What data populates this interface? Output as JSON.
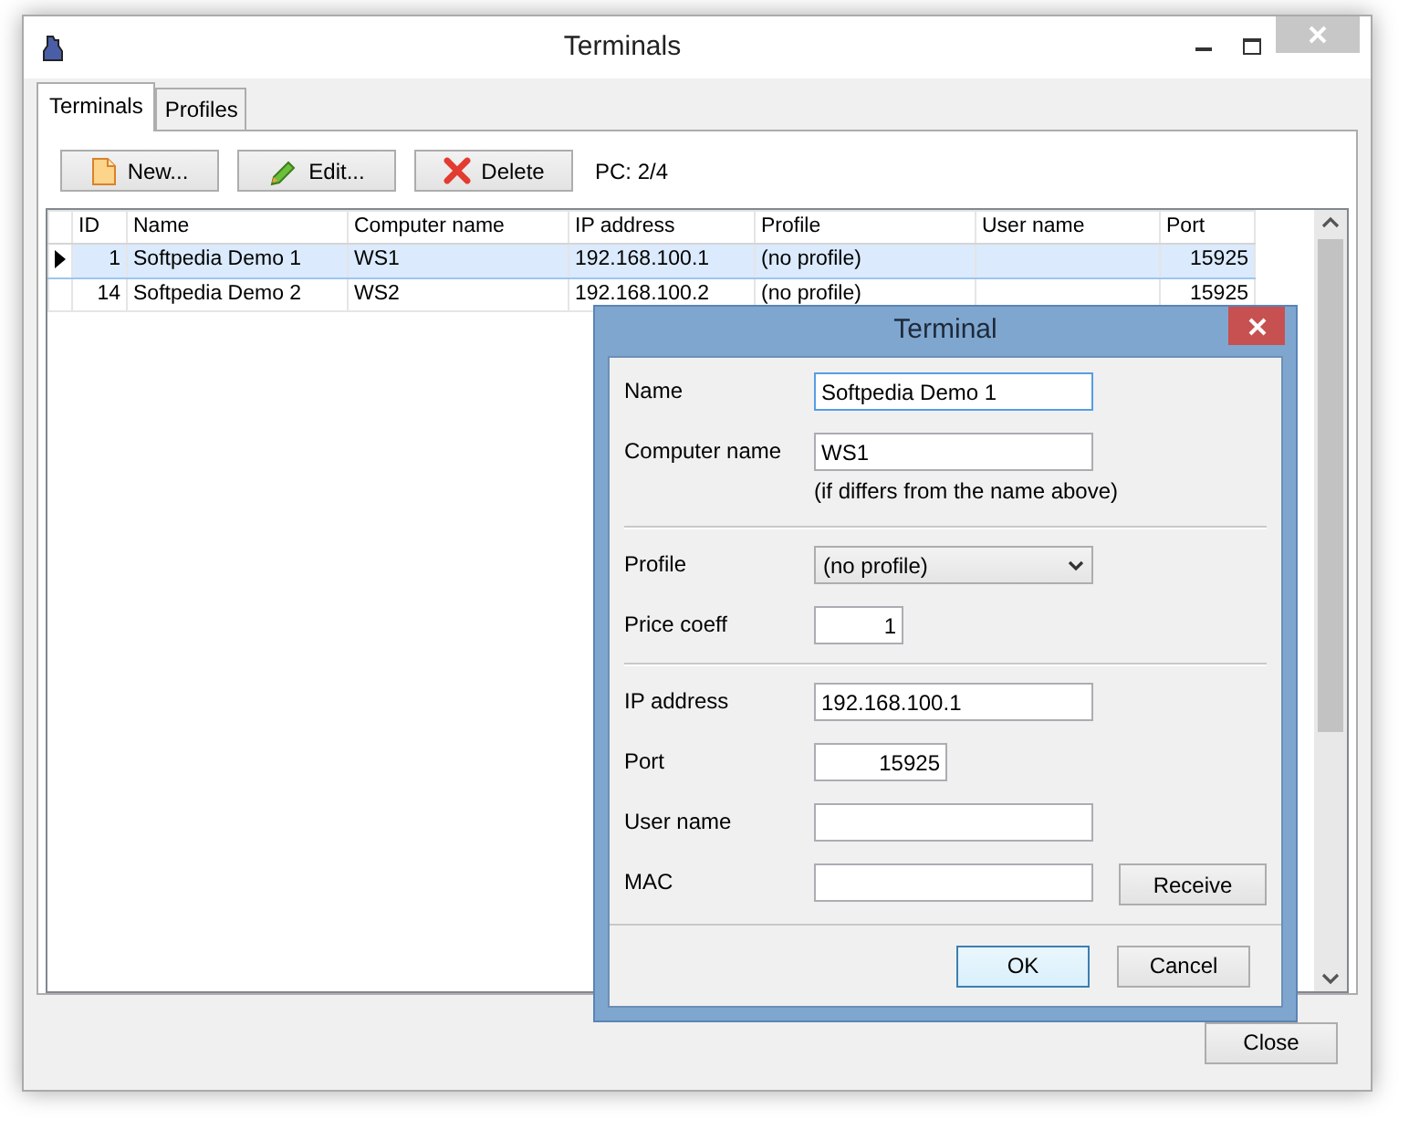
{
  "window": {
    "title": "Terminals"
  },
  "tabs": [
    {
      "label": "Terminals",
      "selected": true
    },
    {
      "label": "Profiles",
      "selected": false
    }
  ],
  "toolbar": [
    {
      "label": "New...",
      "kind": "new"
    },
    {
      "label": "Edit...",
      "kind": "edit"
    },
    {
      "label": "Delete",
      "kind": "delete"
    }
  ],
  "pc_count": "PC: 2/4",
  "table": {
    "columns": [
      "ID",
      "Name",
      "Computer name",
      "IP address",
      "Profile",
      "User name",
      "Port"
    ],
    "rows": [
      {
        "selected": true,
        "cells": [
          "1",
          "Softpedia Demo 1",
          "WS1",
          "192.168.100.1",
          "(no profile)",
          "",
          "15925"
        ]
      },
      {
        "selected": false,
        "cells": [
          "14",
          "Softpedia Demo 2",
          "WS2",
          "192.168.100.2",
          "(no profile)",
          "",
          "15925"
        ]
      }
    ]
  },
  "close_button": "Close",
  "dialog": {
    "title": "Terminal",
    "sections": [
      [
        {
          "label": "Name",
          "kind": "text",
          "value": "Softpedia Demo 1",
          "focused": true
        },
        {
          "label": "Computer name",
          "kind": "text",
          "value": "WS1",
          "focused": false,
          "note": "(if differs from the name above)"
        }
      ],
      [
        {
          "label": "Profile",
          "kind": "select",
          "value": "(no profile)",
          "focused": false
        },
        {
          "label": "Price coeff",
          "kind": "number",
          "value": "1",
          "focused": false
        }
      ],
      [
        {
          "label": "IP address",
          "kind": "text",
          "value": "192.168.100.1",
          "focused": false
        },
        {
          "label": "Port",
          "kind": "number",
          "value": "15925",
          "focused": false
        },
        {
          "label": "User name",
          "kind": "text",
          "focused": false
        },
        {
          "label": "MAC",
          "kind": "text",
          "focused": false,
          "action": "Receive"
        }
      ]
    ],
    "buttons": [
      {
        "label": "OK",
        "default": true
      },
      {
        "label": "Cancel",
        "default": false
      }
    ]
  }
}
